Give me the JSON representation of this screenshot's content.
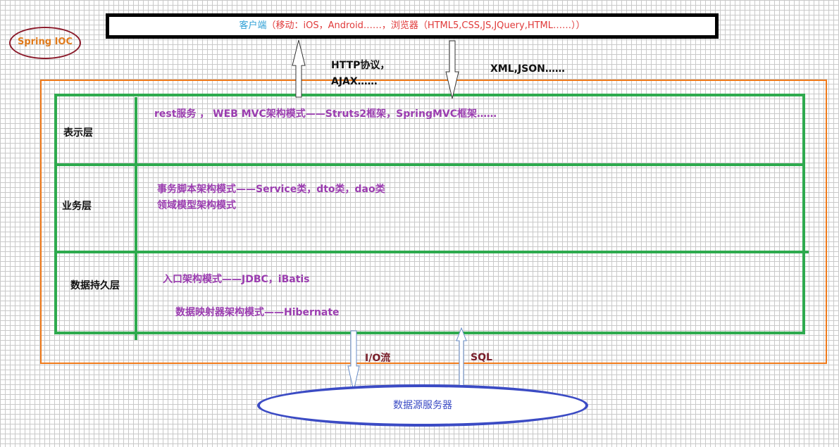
{
  "client": {
    "label": "客户端",
    "detail": "（移动：iOS，Android……，浏览器（HTML5,CSS,JS,JQuery,HTML……））"
  },
  "spring": {
    "label": "Spring IOC"
  },
  "protocols": {
    "http": "HTTP协议，",
    "ajax": "AJAX……",
    "formats": "XML,JSON……"
  },
  "layers": [
    {
      "name": "表示层",
      "lines": [
        "rest服务 ， WEB MVC架构模式——Struts2框架，SpringMVC框架……"
      ]
    },
    {
      "name": "业务层",
      "lines": [
        "事务脚本架构模式——Service类，dto类，dao类",
        "领域模型架构模式"
      ]
    },
    {
      "name": "数据持久层",
      "lines": [
        "入口架构模式——JDBC，iBatis",
        "数据映射器架构模式——Hibernate"
      ]
    }
  ],
  "bottom": {
    "io": "I/O流",
    "sql": "SQL",
    "datasource": "数据源服务器"
  },
  "colors": {
    "green": "#2eaa4e",
    "orange": "#f07a1a",
    "purple": "#9b3db0",
    "blue": "#3b4bc4",
    "maroon": "#7a1e2a"
  }
}
